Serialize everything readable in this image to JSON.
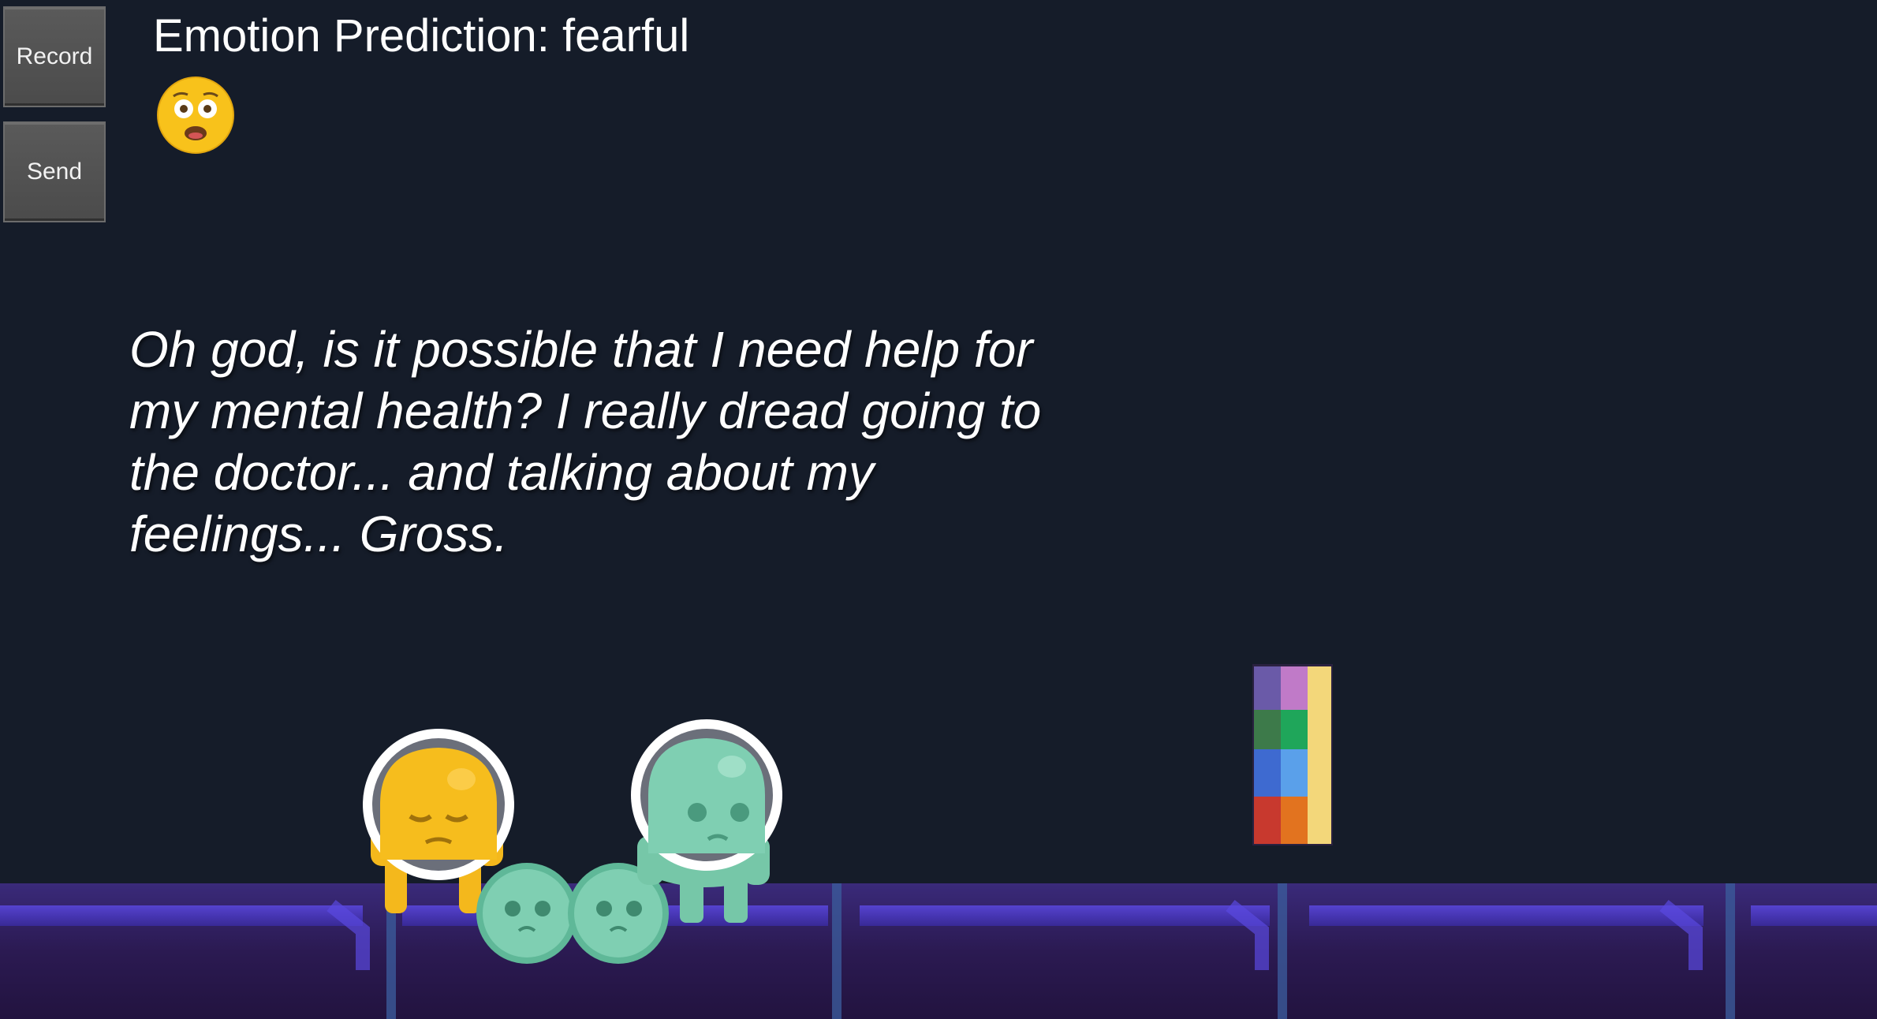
{
  "controls": {
    "record_label": "Record",
    "send_label": "Send"
  },
  "prediction": {
    "text": "Emotion Prediction: fearful",
    "emoji_icon": "fearful-face-icon"
  },
  "dialogue": {
    "text": "Oh god, is it possible that I need help for my mental health? I really dread going to the doctor... and talking about my feelings... Gross."
  },
  "colors": {
    "background": "#151c29",
    "floor": "#2c1a52",
    "floor_glow": "#4a36c4",
    "yellow_character": "#f4b81c",
    "teal_character": "#7fcfb2"
  }
}
